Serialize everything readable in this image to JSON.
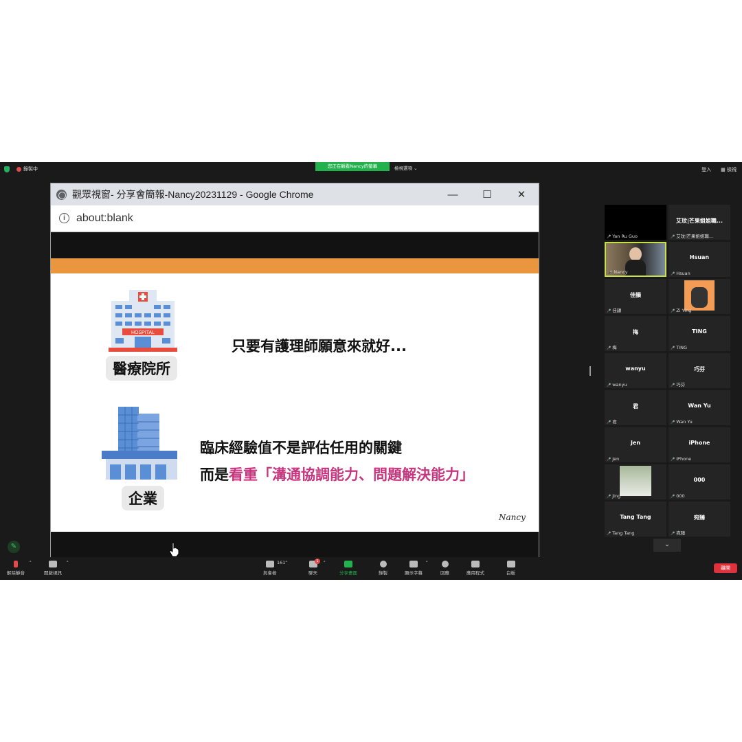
{
  "zoom": {
    "recording": "錄製中",
    "view_banner": "您正在觀看Nancy的螢幕",
    "view_options": "檢視選項",
    "top_right": [
      "登入",
      "檢視"
    ],
    "toolbar": {
      "mute": "解除靜音",
      "video": "開啟視訊",
      "participants": "與會者",
      "participants_count": "161",
      "chat": "聊天",
      "chat_badge": "1",
      "share": "分享畫面",
      "record": "錄製",
      "captions": "顯示字幕",
      "reactions": "回應",
      "apps": "應用程式",
      "whiteboard": "白板",
      "end": "離開"
    }
  },
  "chrome": {
    "title": "觀眾視窗- 分享會簡報-Nancy20231129 - Google Chrome",
    "address": "about:blank"
  },
  "slide": {
    "label1": "醫療院所",
    "text1": "只要有護理師願意來就好...",
    "label2": "企業",
    "text2": "臨床經驗值不是評估任用的關鍵",
    "text3_prefix": "而是",
    "text3_highlight": "看重「溝通協調能力、問題解決能力」",
    "hospital_sign": "HOSPITAL",
    "signature": "Nancy"
  },
  "participants": [
    {
      "name": "",
      "label": "Yan Ru Guo"
    },
    {
      "name": "艾玟|芒果姐姐職...",
      "label": "艾玟|芒果姐姐職..."
    },
    {
      "name": "",
      "label": "Nancy"
    },
    {
      "name": "Hsuan",
      "label": "Hsuan"
    },
    {
      "name": "佳韻",
      "label": "佳韻"
    },
    {
      "name": "",
      "label": "Zi Ying"
    },
    {
      "name": "梅",
      "label": "梅"
    },
    {
      "name": "TING",
      "label": "TING"
    },
    {
      "name": "wanyu",
      "label": "wanyu"
    },
    {
      "name": "巧芬",
      "label": "巧芬"
    },
    {
      "name": "君",
      "label": "君"
    },
    {
      "name": "Wan Yu",
      "label": "Wan Yu"
    },
    {
      "name": "Jen",
      "label": "Jen"
    },
    {
      "name": "iPhone",
      "label": "iPhone"
    },
    {
      "name": "",
      "label": "Jing"
    },
    {
      "name": "000",
      "label": "000"
    },
    {
      "name": "Tang Tang",
      "label": "Tang Tang"
    },
    {
      "name": "宛臻",
      "label": "宛臻"
    }
  ],
  "colors": {
    "accent_orange": "#e9963f",
    "highlight_pink": "#c8357e",
    "share_green": "#22b14c",
    "end_red": "#e0323c",
    "active_speaker": "#c8e04a"
  }
}
